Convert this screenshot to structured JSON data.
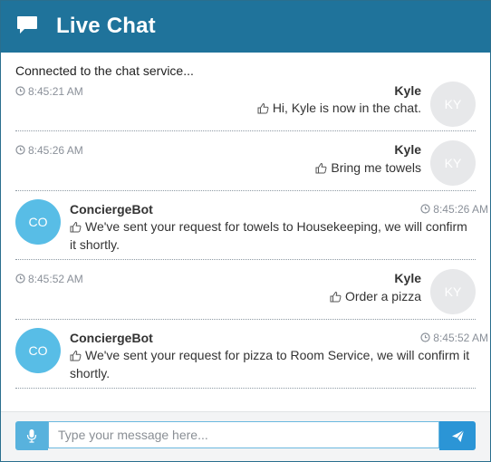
{
  "header": {
    "title": "Live Chat",
    "icon": "chat-bubble-icon",
    "bg_color": "#1f739b"
  },
  "status": "Connected to the chat service...",
  "messages": [
    {
      "author": "Kyle",
      "time": "8:45:21 AM",
      "text": "Hi, Kyle is now in the chat.",
      "avatar": "KY",
      "side": "right"
    },
    {
      "author": "Kyle",
      "time": "8:45:26 AM",
      "text": "Bring me towels",
      "avatar": "KY",
      "side": "right"
    },
    {
      "author": "ConciergeBot",
      "time": "8:45:26 AM",
      "text_line1": "We've sent your request for towels to Housekeeping, we will confirm",
      "text_line2": "it shortly.",
      "avatar": "CO",
      "side": "left"
    },
    {
      "author": "Kyle",
      "time": "8:45:52 AM",
      "text": "Order a pizza",
      "avatar": "KY",
      "side": "right"
    },
    {
      "author": "ConciergeBot",
      "time": "8:45:52 AM",
      "text_line1": "We've sent your request for pizza to Room Service, we will confirm it",
      "text_line2": "shortly.",
      "avatar": "CO",
      "side": "left"
    }
  ],
  "composer": {
    "placeholder": "Type your message here...",
    "value": "",
    "mic_icon": "microphone-icon",
    "send_icon": "paper-plane-icon"
  },
  "colors": {
    "bot_avatar": "#58bde6",
    "user_avatar": "#e7e8ea",
    "send_button": "#2b95d6",
    "mic_button": "#58b2dd"
  }
}
